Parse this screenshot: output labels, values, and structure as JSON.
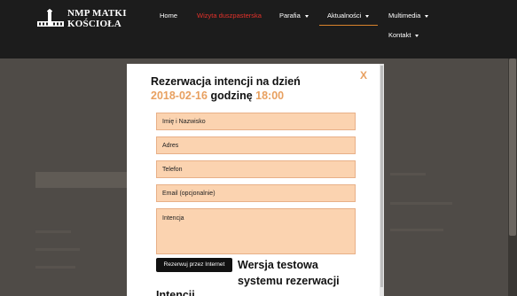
{
  "header": {
    "logo_line1": "NMP MATKI",
    "logo_line2": "KOŚCIOŁA",
    "nav": {
      "home": "Home",
      "wizyta": "Wizyta duszpasterska",
      "parafia": "Parafia",
      "aktualnosci": "Aktualności",
      "multimedia": "Multimedia",
      "kontakt": "Kontakt"
    }
  },
  "modal": {
    "close_label": "X",
    "title_prefix": "Rezerwacja intencji na dzień",
    "date": "2018-02-16",
    "title_mid": "godzinę",
    "time": "18:00",
    "fields": {
      "name_placeholder": "Imię i Nazwisko",
      "address_placeholder": "Adres",
      "phone_placeholder": "Telefon",
      "email_placeholder": "Email (opcjonalnie)",
      "intention_placeholder": "Intencja"
    },
    "submit_label": "Rezerwuj przez Internet",
    "beta_note": "Wersja testowa systemu rezerwacji",
    "cut_text": "Intencji"
  },
  "colors": {
    "accent": "#e8a060",
    "field_bg": "#fbd3b0",
    "nav_active": "#e4322b"
  }
}
